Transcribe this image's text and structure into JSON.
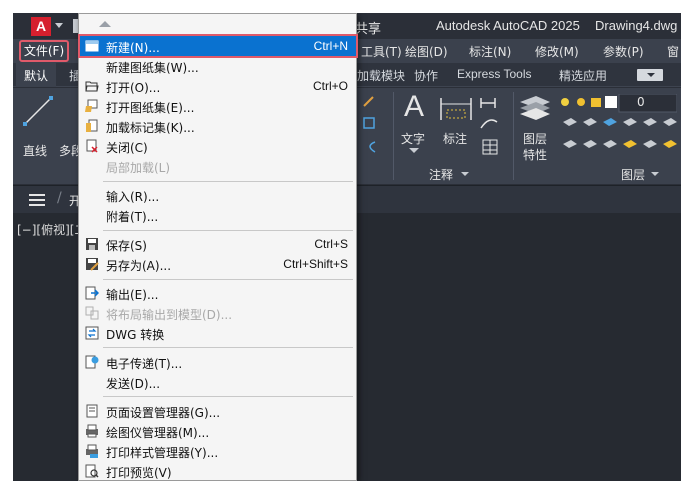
{
  "app": {
    "logo_letter": "A",
    "share_label": "共享",
    "app_title": "Autodesk AutoCAD 2025",
    "doc_title": "Drawing4.dwg"
  },
  "menubar": {
    "file": "文件(F)",
    "items": [
      "工具(T)",
      "绘图(D)",
      "标注(N)",
      "修改(M)",
      "参数(P)",
      "窗"
    ]
  },
  "ribbon_tabs": {
    "active": "默认",
    "partial": "插",
    "items": [
      "加载模块",
      "协作",
      "Express Tools",
      "精选应用"
    ]
  },
  "ribbon": {
    "line_label": "直线",
    "multiline_label": "多段",
    "text_label": "文字",
    "dim_label": "标注",
    "annotation_group": "注释",
    "layer_props_line1": "图层",
    "layer_props_line2": "特性",
    "layer_group": "图层",
    "layer_value": "0"
  },
  "filebar": {
    "start_tab_partial": "开"
  },
  "canvas": {
    "viewport_label": "[−][俯视][二"
  },
  "colors": {
    "accent": "#0a72d0",
    "highlight_outline": "#e05a6a",
    "logo": "#d6202e"
  },
  "file_menu": {
    "items": [
      {
        "label": "新建(N)...",
        "shortcut": "Ctrl+N",
        "icon": "new-icon",
        "highlight": true
      },
      {
        "label": "新建图纸集(W)...",
        "shortcut": "",
        "icon": ""
      },
      {
        "label": "打开(O)...",
        "shortcut": "Ctrl+O",
        "icon": "open-folder-icon"
      },
      {
        "label": "打开图纸集(E)...",
        "shortcut": "",
        "icon": "open-sheetset-icon"
      },
      {
        "label": "加载标记集(K)...",
        "shortcut": "",
        "icon": "markup-icon"
      },
      {
        "label": "关闭(C)",
        "shortcut": "",
        "icon": "close-doc-icon"
      },
      {
        "label": "局部加载(L)",
        "shortcut": "",
        "icon": "",
        "disabled": true
      },
      {
        "label": "输入(R)...",
        "shortcut": "",
        "icon": ""
      },
      {
        "label": "附着(T)...",
        "shortcut": "",
        "icon": ""
      },
      {
        "label": "保存(S)",
        "shortcut": "Ctrl+S",
        "icon": "save-icon"
      },
      {
        "label": "另存为(A)...",
        "shortcut": "Ctrl+Shift+S",
        "icon": "save-as-icon"
      },
      {
        "label": "输出(E)...",
        "shortcut": "",
        "icon": "export-icon"
      },
      {
        "label": "将布局输出到模型(D)...",
        "shortcut": "",
        "icon": "layout-export-icon",
        "disabled": true
      },
      {
        "label": "DWG 转换",
        "shortcut": "",
        "icon": "dwg-convert-icon"
      },
      {
        "label": "电子传递(T)...",
        "shortcut": "",
        "icon": "etransmit-icon"
      },
      {
        "label": "发送(D)...",
        "shortcut": "",
        "icon": ""
      },
      {
        "label": "页面设置管理器(G)...",
        "shortcut": "",
        "icon": "page-setup-icon"
      },
      {
        "label": "绘图仪管理器(M)...",
        "shortcut": "",
        "icon": "plotter-icon"
      },
      {
        "label": "打印样式管理器(Y)...",
        "shortcut": "",
        "icon": "plot-style-icon"
      },
      {
        "label": "打印预览(V)",
        "shortcut": "",
        "icon": "print-preview-icon"
      }
    ]
  }
}
